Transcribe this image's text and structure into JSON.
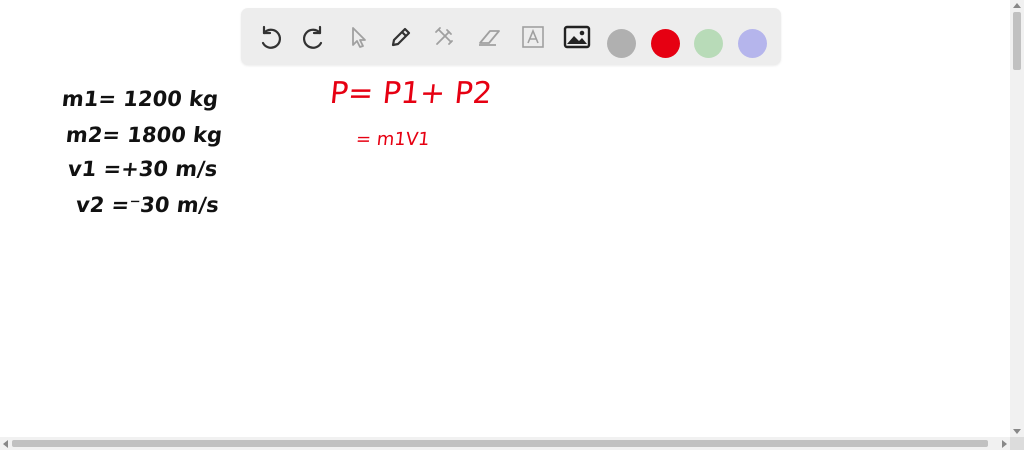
{
  "toolbar": {
    "tools": [
      {
        "name": "undo-icon"
      },
      {
        "name": "redo-icon"
      },
      {
        "name": "select-pointer-icon"
      },
      {
        "name": "pen-icon"
      },
      {
        "name": "tools-icon"
      },
      {
        "name": "eraser-icon"
      },
      {
        "name": "text-box-icon"
      },
      {
        "name": "image-icon"
      }
    ],
    "colors": [
      "#b0b0b0",
      "#e60012",
      "#b8dbb8",
      "#b5b5ec"
    ]
  },
  "notes": {
    "left": [
      "m1= 1200 kg",
      "m2= 1800 kg",
      "v1 =+30 m/s",
      "v2 =⁻30 m/s"
    ],
    "right": [
      "P= P1+ P2",
      "= m1V1"
    ]
  }
}
